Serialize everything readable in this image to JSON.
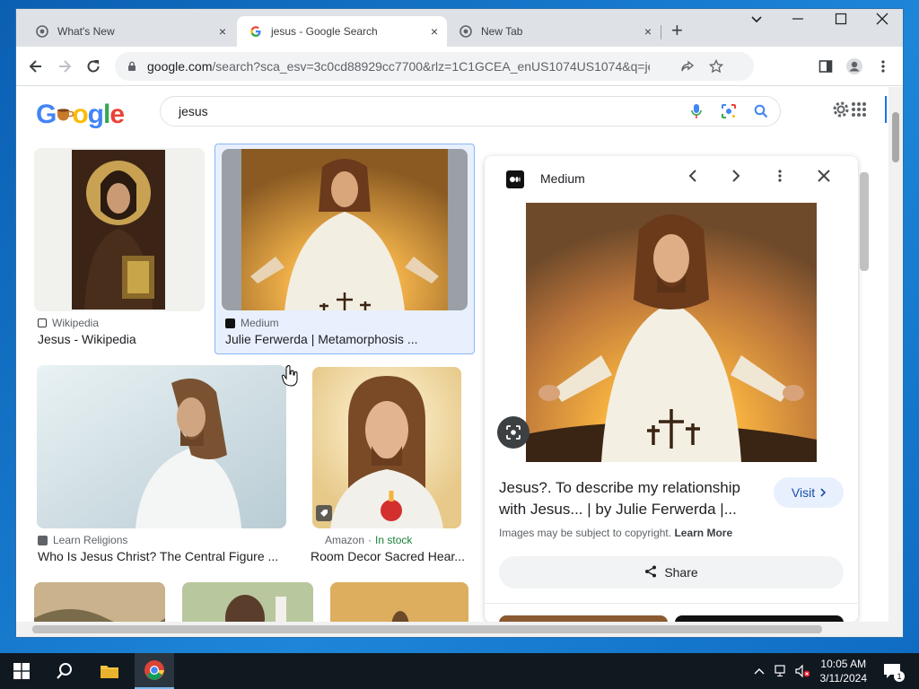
{
  "browser": {
    "tabs": [
      {
        "title": "What's New",
        "close": "×"
      },
      {
        "title": "jesus - Google Search",
        "close": "×"
      },
      {
        "title": "New Tab",
        "close": "×"
      }
    ],
    "new_tab": "+",
    "url_host": "google.com",
    "url_rest": "/search?sca_esv=3c0cd88929cc7700&rlz=1C1GCEA_enUS1074US1074&q=jesus&tbm=isch&s..."
  },
  "google": {
    "logo": "Google",
    "logo_colors": [
      "#4285f4",
      "#ea4335",
      "#fbbc05",
      "#4285f4",
      "#34a853",
      "#ea4335"
    ],
    "query": "jesus"
  },
  "results": [
    {
      "source": "Wikipedia",
      "title": "Jesus - Wikipedia"
    },
    {
      "source": "Medium",
      "title": "Julie Ferwerda | Metamorphosis ..."
    },
    {
      "source": "Learn Religions",
      "title": "Who Is Jesus Christ? The Central Figure ..."
    },
    {
      "source": "Amazon",
      "stock": "In stock",
      "title": "Room Decor Sacred Hear..."
    }
  ],
  "panel": {
    "source": "Medium",
    "title": "Jesus?. To describe my relationship with Jesus... | by Julie Ferwerda |...",
    "visit": "Visit",
    "copyright": "Images may be subject to copyright.",
    "learn_more": "Learn More",
    "share": "Share"
  },
  "taskbar": {
    "time": "10:05 AM",
    "date": "3/11/2024",
    "notifications": "1"
  },
  "colors": {
    "accent": "#1a73e8",
    "stock_green": "#188038",
    "selection": "#e8f0fe"
  }
}
